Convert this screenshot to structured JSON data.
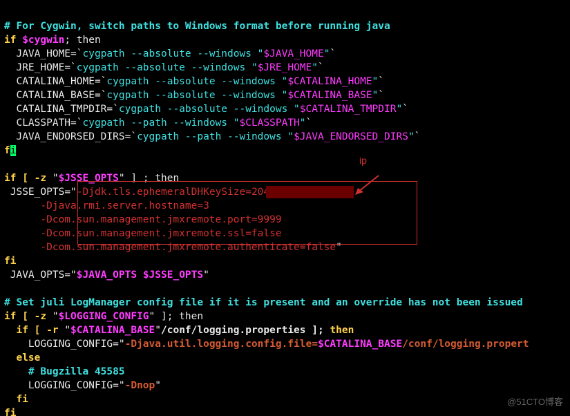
{
  "lines": {
    "comment_cygwin": "# For Cygwin, switch paths to Windows format before running java",
    "if_cygwin_if": "if ",
    "if_cygwin_var": "$cygwin",
    "if_cygwin_then": "; then",
    "jh_lhs": "  JAVA_HOME",
    "eq": "=",
    "bq": "`",
    "cyg_abs_win": "cygpath --absolute --windows ",
    "cyg_path_win": "cygpath --path --windows ",
    "q": "\"",
    "jh_var": "$JAVA_HOME",
    "jre_lhs": "  JRE_HOME",
    "jre_var": "$JRE_HOME",
    "ch_lhs": "  CATALINA_HOME",
    "ch_var": "$CATALINA_HOME",
    "cb_lhs": "  CATALINA_BASE",
    "cb_var": "$CATALINA_BASE",
    "ct_lhs": "  CATALINA_TMPDIR",
    "ct_var": "$CATALINA_TMPDIR",
    "cp_lhs": "  CLASSPATH",
    "cp_var": "$CLASSPATH",
    "jed_lhs": "  JAVA_ENDORSED_DIRS",
    "jed_var": "$JAVA_ENDORSED_DIRS",
    "fi_f": "f",
    "fi_i": "i",
    "if_jsse_1": "if [ -z ",
    "jsse_var": "$JSSE_OPTS",
    "if_jsse_2": " ] ; then",
    "jsse_lhs": " JSSE_OPTS",
    "jsse_l1": "-Djdk.tls.ephemeralDHKeySize=2048",
    "jsse_l2": "      -Djava.rmi.server.hostname=3",
    "jsse_l3": "      -Dcom.sun.management.jmxremote.port=9999",
    "jsse_l4": "      -Dcom.sun.management.jmxremote.ssl=false",
    "jsse_l5": "      -Dcom.sun.management.jmxremote.authenticate=false",
    "fi2": "fi",
    "java_opts_lhs": " JAVA_OPTS",
    "java_opts_var1": "$JAVA_OPTS",
    "sp": " ",
    "java_opts_var2": "$JSSE_OPTS",
    "comment_juli": "# Set juli LogManager config file if it is present and an override has not been issued",
    "if_log_1": "if [ -z ",
    "log_cfg_var": "$LOGGING_CONFIG",
    "if_log_2": " ]; then",
    "if_r_1": "  if [ -r ",
    "if_r_path": "/conf/logging.properties ]; ",
    "then": "then",
    "log_cfg_lhs": "    LOGGING_CONFIG",
    "log_cfg_val_a": "-Djava.util.logging.config.file=",
    "log_cfg_val_b": "$CATALINA_BASE",
    "log_cfg_val_c": "/conf/logging.propert",
    "else": "  else",
    "comment_bugzilla": "    # Bugzilla 45585",
    "dnop": "-Dnop",
    "fi_inner": "  fi",
    "fi_outer": "fi"
  },
  "annotation": {
    "label": "ip"
  },
  "watermark": "@51CTO博客"
}
